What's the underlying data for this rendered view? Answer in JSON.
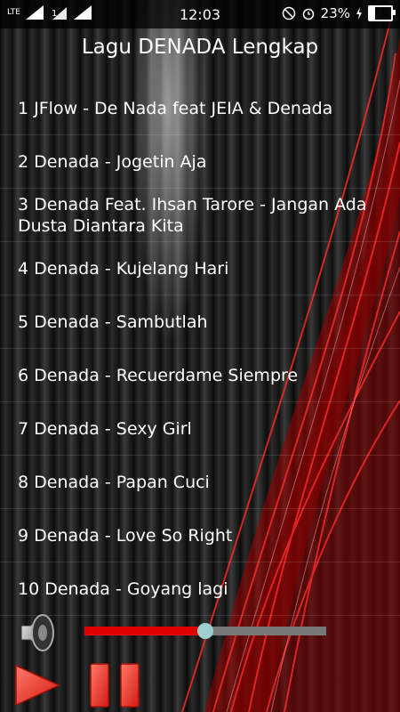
{
  "status": {
    "network": "LTE",
    "time": "12:03",
    "battery_percent_label": "23%",
    "battery_level": 0.23
  },
  "title": "Lagu DENADA Lengkap",
  "songs": [
    "1 JFlow - De Nada feat JEIA & Denada",
    "2 Denada - Jogetin Aja",
    "3 Denada Feat. Ihsan Tarore - Jangan Ada Dusta Diantara Kita",
    "4 Denada - Kujelang Hari",
    "5 Denada - Sambutlah",
    "6 Denada - Recuerdame Siempre",
    "7 Denada - Sexy Girl",
    "8 Denada - Papan Cuci",
    "9 Denada - Love So Right",
    "10 Denada - Goyang lagi"
  ],
  "player": {
    "progress": 0.5,
    "icons": [
      "speaker-icon",
      "play-icon",
      "pause-icon"
    ]
  },
  "colors": {
    "accent_red": "#e00000",
    "thumb": "#9ccfcf",
    "track": "#777777"
  }
}
